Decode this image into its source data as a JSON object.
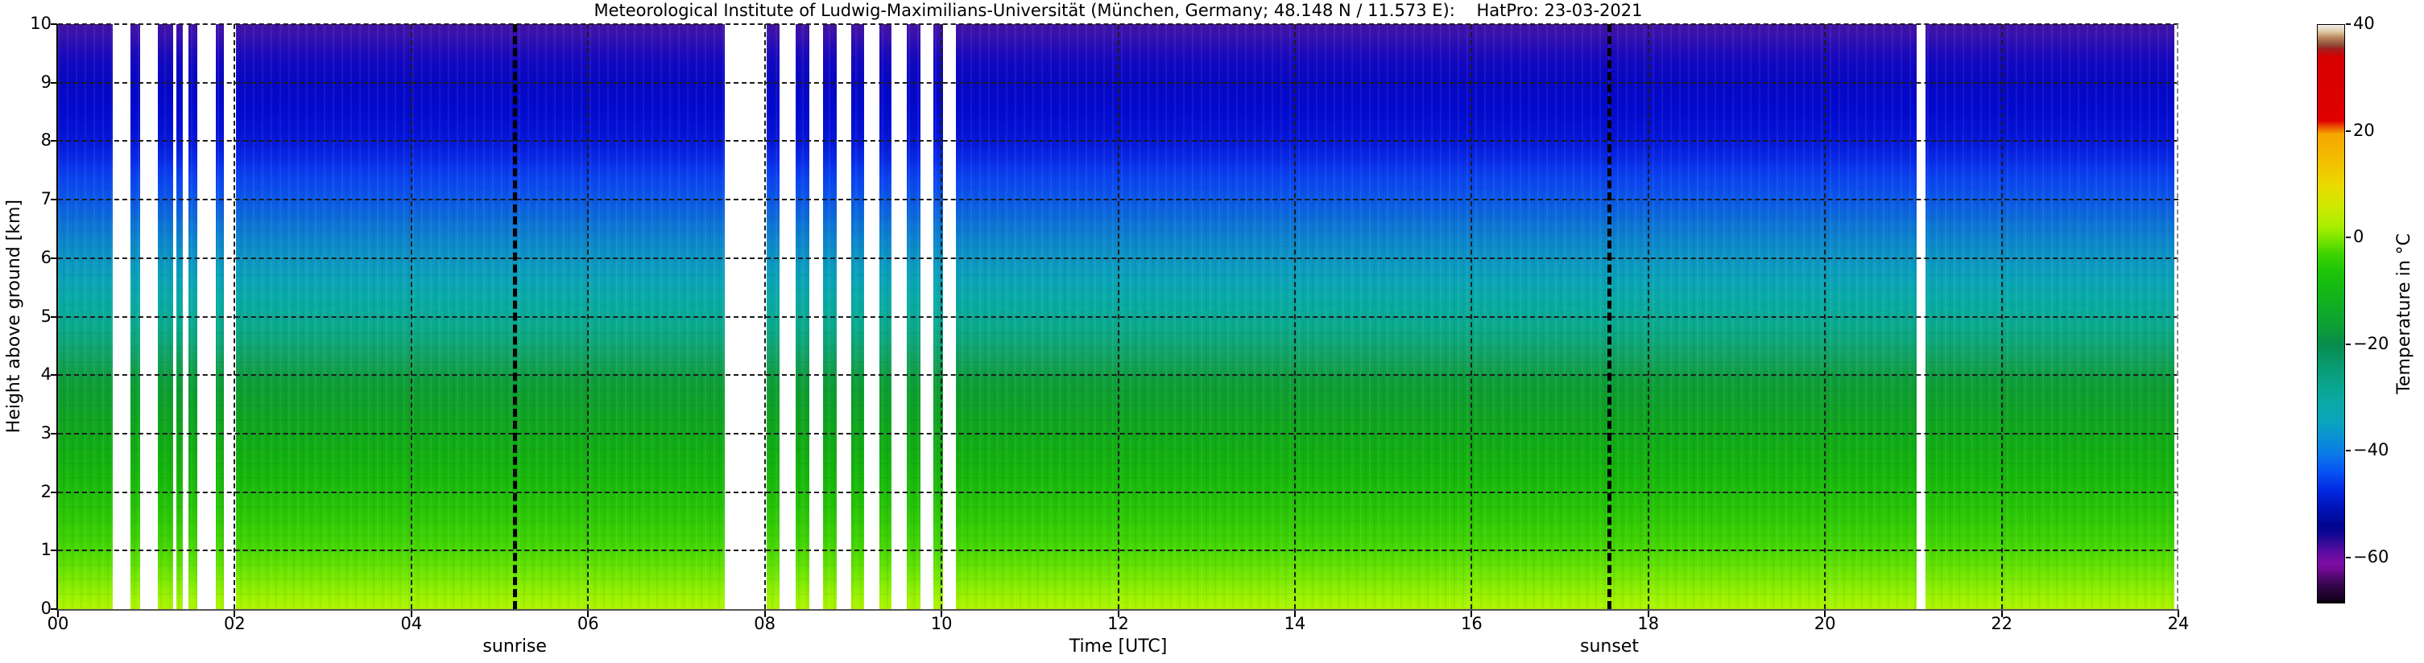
{
  "title": "Meteorological Institute of Ludwig-Maximilians-Universität (München, Germany; 48.148 N / 11.573 E):    HatPro: 23-03-2021",
  "chart_data": {
    "type": "heatmap",
    "title": "Meteorological Institute of Ludwig-Maximilians-Universität (München, Germany; 48.148 N / 11.573 E):    HatPro: 23-03-2021",
    "instrument": "HatPro",
    "date": "23-03-2021",
    "xlabel": "Time [UTC]",
    "ylabel": "Height above ground [km]",
    "colorbar_label": "Temperature in  °C",
    "x_range_hours": [
      0,
      24
    ],
    "x_tick_values": [
      0,
      2,
      4,
      6,
      8,
      10,
      12,
      14,
      16,
      18,
      20,
      22,
      24
    ],
    "x_tick_labels": [
      "00",
      "02",
      "04",
      "06",
      "08",
      "10",
      "12",
      "14",
      "16",
      "18",
      "20",
      "22",
      "24"
    ],
    "y_range_km": [
      0,
      10
    ],
    "y_tick_values": [
      0,
      1,
      2,
      3,
      4,
      5,
      6,
      7,
      8,
      9,
      10
    ],
    "y_tick_labels": [
      "0",
      "1",
      "2",
      "3",
      "4",
      "5",
      "6",
      "7",
      "8",
      "9",
      "10"
    ],
    "grid": {
      "style": "dashed",
      "color": "#1c1c1c",
      "x_step_hours": 2,
      "y_step_km": 1
    },
    "events": [
      {
        "label": "sunrise",
        "hour": 5.17
      },
      {
        "label": "sunset",
        "hour": 17.56
      }
    ],
    "data_gaps_hours": [
      [
        0.62,
        0.82
      ],
      [
        0.93,
        1.13
      ],
      [
        1.3,
        1.34
      ],
      [
        1.41,
        1.48
      ],
      [
        1.58,
        1.79
      ],
      [
        1.88,
        2.01
      ],
      [
        7.55,
        8.02
      ],
      [
        8.17,
        8.35
      ],
      [
        8.5,
        8.66
      ],
      [
        8.81,
        8.98
      ],
      [
        9.12,
        9.3
      ],
      [
        9.43,
        9.61
      ],
      [
        9.76,
        9.91
      ],
      [
        10.02,
        10.16
      ],
      [
        21.04,
        21.14
      ],
      [
        23.95,
        24.0
      ]
    ],
    "temperature_profile": [
      {
        "km": 10.0,
        "color": "#4113a4",
        "approx_temp_c": -59
      },
      {
        "km": 9.8,
        "color": "#3811b0",
        "approx_temp_c": -58
      },
      {
        "km": 9.55,
        "color": "#200bba",
        "approx_temp_c": -56
      },
      {
        "km": 9.3,
        "color": "#1008c2",
        "approx_temp_c": -54
      },
      {
        "km": 9.0,
        "color": "#0707c4",
        "approx_temp_c": -53
      },
      {
        "km": 8.6,
        "color": "#0309ce",
        "approx_temp_c": -52
      },
      {
        "km": 8.2,
        "color": "#0411d6",
        "approx_temp_c": -50
      },
      {
        "km": 8.0,
        "color": "#0518da",
        "approx_temp_c": -49
      },
      {
        "km": 7.8,
        "color": "#0723e2",
        "approx_temp_c": -48
      },
      {
        "km": 7.6,
        "color": "#0931ea",
        "approx_temp_c": -46
      },
      {
        "km": 7.45,
        "color": "#0a3eef",
        "approx_temp_c": -45
      },
      {
        "km": 7.2,
        "color": "#0b4cee",
        "approx_temp_c": -44
      },
      {
        "km": 7.0,
        "color": "#0b58e8",
        "approx_temp_c": -43
      },
      {
        "km": 6.8,
        "color": "#0c64de",
        "approx_temp_c": -41
      },
      {
        "km": 6.6,
        "color": "#0d73d6",
        "approx_temp_c": -39
      },
      {
        "km": 6.4,
        "color": "#0d7fd0",
        "approx_temp_c": -38
      },
      {
        "km": 6.2,
        "color": "#0c8bca",
        "approx_temp_c": -36
      },
      {
        "km": 6.0,
        "color": "#0c95c4",
        "approx_temp_c": -35
      },
      {
        "km": 5.8,
        "color": "#0b9dbe",
        "approx_temp_c": -33
      },
      {
        "km": 5.6,
        "color": "#0aa4b6",
        "approx_temp_c": -31
      },
      {
        "km": 5.4,
        "color": "#0aa9ac",
        "approx_temp_c": -30
      },
      {
        "km": 5.2,
        "color": "#09aba2",
        "approx_temp_c": -28
      },
      {
        "km": 5.0,
        "color": "#0aab98",
        "approx_temp_c": -27
      },
      {
        "km": 4.8,
        "color": "#0ba98a",
        "approx_temp_c": -25
      },
      {
        "km": 4.6,
        "color": "#0ea77c",
        "approx_temp_c": -23
      },
      {
        "km": 4.4,
        "color": "#10a46a",
        "approx_temp_c": -21
      },
      {
        "km": 4.2,
        "color": "#12a158",
        "approx_temp_c": -19
      },
      {
        "km": 4.0,
        "color": "#0f9e42",
        "approx_temp_c": -17
      },
      {
        "km": 3.8,
        "color": "#0d9e34",
        "approx_temp_c": -15
      },
      {
        "km": 3.55,
        "color": "#0ea02b",
        "approx_temp_c": -14
      },
      {
        "km": 3.3,
        "color": "#0fa322",
        "approx_temp_c": -13
      },
      {
        "km": 3.0,
        "color": "#10a81b",
        "approx_temp_c": -12
      },
      {
        "km": 2.7,
        "color": "#12ae13",
        "approx_temp_c": -10
      },
      {
        "km": 2.4,
        "color": "#15b40e",
        "approx_temp_c": -9
      },
      {
        "km": 2.1,
        "color": "#1bbb0a",
        "approx_temp_c": -8
      },
      {
        "km": 1.8,
        "color": "#24c207",
        "approx_temp_c": -6
      },
      {
        "km": 1.5,
        "color": "#30ca05",
        "approx_temp_c": -5
      },
      {
        "km": 1.2,
        "color": "#3ed204",
        "approx_temp_c": -4
      },
      {
        "km": 1.0,
        "color": "#4ad703",
        "approx_temp_c": -2
      },
      {
        "km": 0.8,
        "color": "#5cdf02",
        "approx_temp_c": -1
      },
      {
        "km": 0.6,
        "color": "#70e601",
        "approx_temp_c": 1
      },
      {
        "km": 0.4,
        "color": "#86ec01",
        "approx_temp_c": 2
      },
      {
        "km": 0.2,
        "color": "#9cf200",
        "approx_temp_c": 4
      },
      {
        "km": 0.0,
        "color": "#b0f600",
        "approx_temp_c": 5
      }
    ],
    "colorbar": {
      "range_c": [
        -68.6,
        40
      ],
      "tick_values": [
        40,
        20,
        0,
        -20,
        -40,
        -60
      ],
      "tick_labels": [
        "40",
        "20",
        "0",
        "−20",
        "−40",
        "−60"
      ],
      "stops": [
        {
          "t": 40.0,
          "color": "#f2f0ee"
        },
        {
          "t": 38.7,
          "color": "#dcc8a2"
        },
        {
          "t": 37.5,
          "color": "#b5805a"
        },
        {
          "t": 36.2,
          "color": "#8f4a38"
        },
        {
          "t": 35.5,
          "color": "#a51e1e"
        },
        {
          "t": 34.0,
          "color": "#d60000"
        },
        {
          "t": 22.0,
          "color": "#e00000"
        },
        {
          "t": 20.4,
          "color": "#ee6f00"
        },
        {
          "t": 19.5,
          "color": "#f6a600"
        },
        {
          "t": 15.5,
          "color": "#f4b800"
        },
        {
          "t": 12.0,
          "color": "#f0cc00"
        },
        {
          "t": 10.0,
          "color": "#ecd900"
        },
        {
          "t": 6.0,
          "color": "#cfe800"
        },
        {
          "t": 2.0,
          "color": "#a8ee00"
        },
        {
          "t": 0.0,
          "color": "#7fe600"
        },
        {
          "t": -3.0,
          "color": "#3fd400"
        },
        {
          "t": -6.0,
          "color": "#1fc607"
        },
        {
          "t": -9.0,
          "color": "#15bb12"
        },
        {
          "t": -13.0,
          "color": "#10ad24"
        },
        {
          "t": -17.0,
          "color": "#0c9e38"
        },
        {
          "t": -20.0,
          "color": "#088c4c"
        },
        {
          "t": -24.0,
          "color": "#099a70"
        },
        {
          "t": -28.0,
          "color": "#0aa590"
        },
        {
          "t": -31.0,
          "color": "#0ba8a6"
        },
        {
          "t": -34.5,
          "color": "#0ba4bc"
        },
        {
          "t": -38.0,
          "color": "#098ed6"
        },
        {
          "t": -40.5,
          "color": "#0b7ce6"
        },
        {
          "t": -44.0,
          "color": "#0653f2"
        },
        {
          "t": -47.5,
          "color": "#0028e0"
        },
        {
          "t": -51.0,
          "color": "#0012b6"
        },
        {
          "t": -54.0,
          "color": "#000692"
        },
        {
          "t": -55.5,
          "color": "#0d0694"
        },
        {
          "t": -57.0,
          "color": "#2d0a96"
        },
        {
          "t": -59.0,
          "color": "#5a0ba0"
        },
        {
          "t": -61.0,
          "color": "#7c0ca6"
        },
        {
          "t": -62.5,
          "color": "#6f0a92"
        },
        {
          "t": -64.0,
          "color": "#4c0768"
        },
        {
          "t": -66.0,
          "color": "#2d0440"
        },
        {
          "t": -68.0,
          "color": "#150220"
        },
        {
          "t": -68.6,
          "color": "#000000"
        }
      ]
    }
  }
}
